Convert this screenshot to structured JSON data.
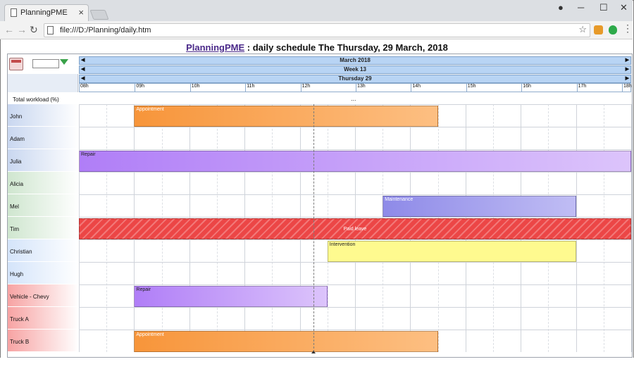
{
  "browser": {
    "tab_title": "PlanningPME",
    "tab_close": "×",
    "url": "file:///D:/Planning/daily.htm"
  },
  "page": {
    "brand": "PlanningPME",
    "title_rest": " : daily schedule The Thursday, 29 March, 2018"
  },
  "header": {
    "month": "March 2018",
    "week": "Week 13",
    "day": "Thursday 29",
    "hours": [
      "08h",
      "09h",
      "10h",
      "11h",
      "12h",
      "13h",
      "14h",
      "15h",
      "16h",
      "17h",
      "18h"
    ]
  },
  "workload": {
    "label": "Total workload (%)",
    "value": "..."
  },
  "resources": [
    {
      "name": "John",
      "group": "blue"
    },
    {
      "name": "Adam",
      "group": "blue"
    },
    {
      "name": "Julia",
      "group": "blue"
    },
    {
      "name": "Alicia",
      "group": "green"
    },
    {
      "name": "Mel",
      "group": "green"
    },
    {
      "name": "Tim",
      "group": "green"
    },
    {
      "name": "Christian",
      "group": "lightblue"
    },
    {
      "name": "Hugh",
      "group": "lightblue"
    },
    {
      "name": "Vehicle - Chevy",
      "group": "red"
    },
    {
      "name": "Truck A",
      "group": "red"
    },
    {
      "name": "Truck B",
      "group": "red"
    }
  ],
  "tasks": [
    {
      "label": "Appointment",
      "row": 0,
      "start": "09:00",
      "end": "14:30",
      "color": "orange"
    },
    {
      "label": "Repair",
      "row": 2,
      "start": "08:00",
      "end": "18:00",
      "color": "purple"
    },
    {
      "label": "Maintenance",
      "row": 4,
      "start": "13:30",
      "end": "17:00",
      "color": "blue"
    },
    {
      "label": "Paid leave",
      "row": 5,
      "start": "08:00",
      "end": "18:00",
      "color": "red"
    },
    {
      "label": "Intervention",
      "row": 6,
      "start": "12:30",
      "end": "17:00",
      "color": "yellow"
    },
    {
      "label": "Repair",
      "row": 8,
      "start": "09:00",
      "end": "12:30",
      "color": "purple"
    },
    {
      "label": "Appointment",
      "row": 10,
      "start": "09:00",
      "end": "14:30",
      "color": "orange"
    }
  ],
  "group_colors": {
    "blue": "#c9d7f0",
    "green": "#cfe6cf",
    "lightblue": "#d4e4fa",
    "red": "#f7a3a3"
  },
  "current_time": "12:15"
}
